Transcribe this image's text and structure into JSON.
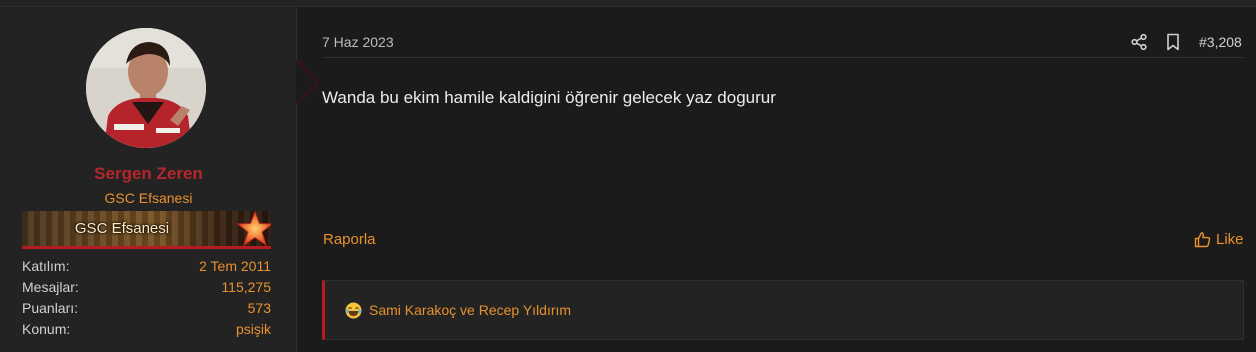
{
  "user": {
    "name": "Sergen Zeren",
    "title": "GSC Efsanesi",
    "banner_text": "GSC Efsanesi",
    "stats": [
      {
        "label": "Katılım:",
        "value": "2 Tem 2011"
      },
      {
        "label": "Mesajlar:",
        "value": "115,275"
      },
      {
        "label": "Puanları:",
        "value": "573"
      },
      {
        "label": "Konum:",
        "value": "psişik"
      }
    ]
  },
  "post": {
    "date": "7 Haz 2023",
    "number": "#3,208",
    "body": "Wanda bu ekim hamile kaldigini öğrenir gelecek yaz dogurur",
    "report_label": "Raporla",
    "like_label": "Like",
    "reactions_text": "Sami Karakoç ve Recep Yıldırım"
  },
  "icons": {
    "share": "share-icon",
    "bookmark": "bookmark-icon",
    "like": "thumbs-up-icon",
    "reaction": "laughing-emoji-icon"
  },
  "colors": {
    "accent": "#e8912f",
    "username": "#b4272b",
    "brand_red": "#b61b22"
  }
}
